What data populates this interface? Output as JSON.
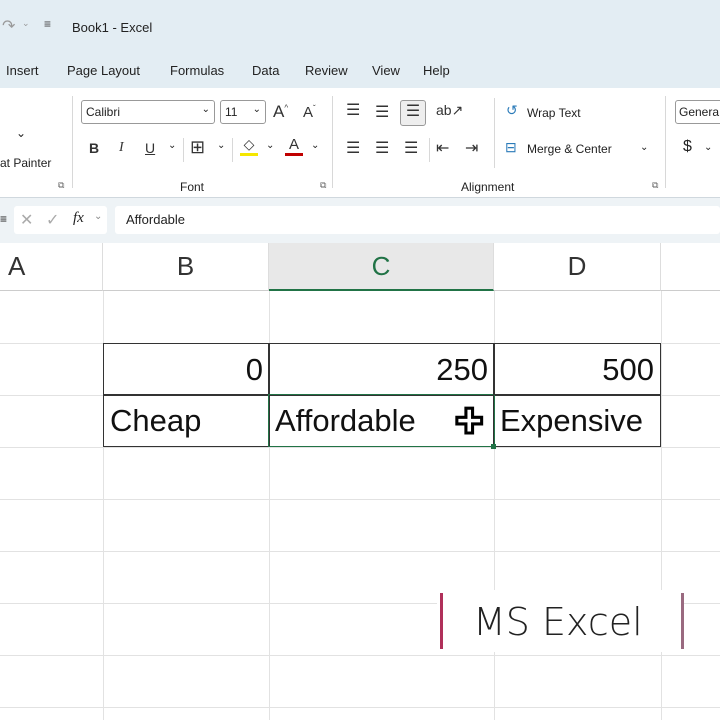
{
  "title": "Book1  -  Excel",
  "menu": [
    "Insert",
    "Page Layout",
    "Formulas",
    "Data",
    "Review",
    "View",
    "Help"
  ],
  "ribbon": {
    "clipboard": {
      "format_painter": "at Painter"
    },
    "font": {
      "name": "Calibri",
      "size": "11",
      "group_label": "Font"
    },
    "alignment": {
      "wrap_text": "Wrap Text",
      "merge_center": "Merge & Center",
      "group_label": "Alignment"
    },
    "number": {
      "format": "Genera",
      "currency": "$"
    }
  },
  "formula_bar": {
    "fx": "fx",
    "value": "Affordable"
  },
  "columns": [
    "A",
    "B",
    "C",
    "D"
  ],
  "cells": {
    "b_num": "0",
    "c_num": "250",
    "d_num": "500",
    "b_text": "Cheap",
    "c_text": "Affordable",
    "d_text": "Expensive"
  },
  "overlay": {
    "label": "MS Excel"
  },
  "colors": {
    "selection": "#217346",
    "fill_yellow": "#f5e700",
    "font_red": "#c00000",
    "overlay_bar": "#b0305a"
  }
}
